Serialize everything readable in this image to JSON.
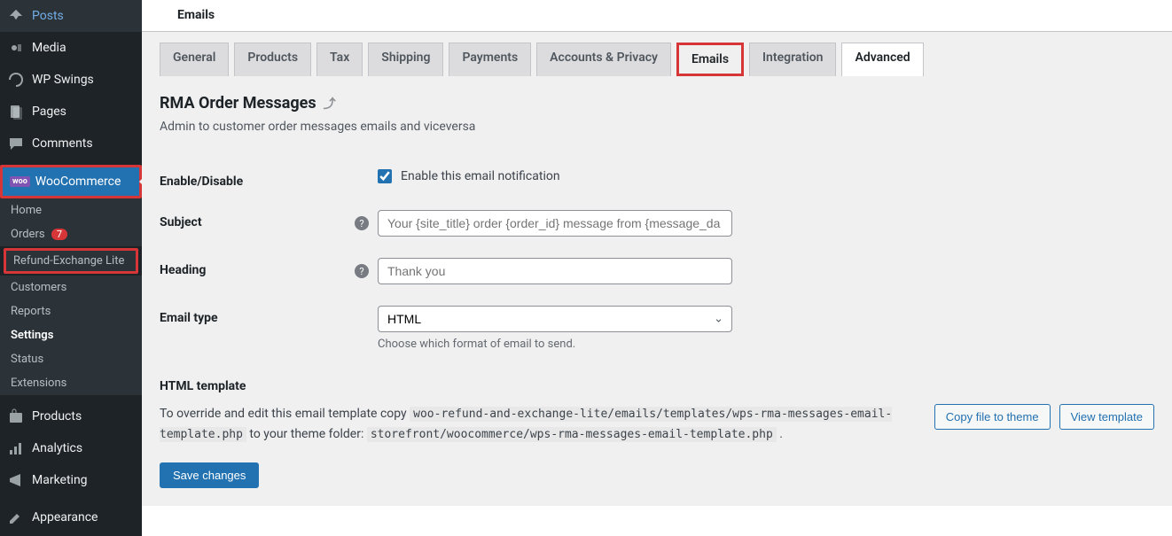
{
  "sidebar": {
    "items": [
      {
        "label": "Posts",
        "icon": "pin"
      },
      {
        "label": "Media",
        "icon": "media"
      },
      {
        "label": "WP Swings",
        "icon": "swings"
      },
      {
        "label": "Pages",
        "icon": "pages"
      },
      {
        "label": "Comments",
        "icon": "comment"
      }
    ],
    "woocommerce": {
      "label": "WooCommerce",
      "badge": "woo"
    },
    "wc_submenu": [
      {
        "label": "Home"
      },
      {
        "label": "Orders",
        "count": "7"
      },
      {
        "label": "Refund-Exchange Lite",
        "highlighted": true
      },
      {
        "label": "Customers"
      },
      {
        "label": "Reports"
      },
      {
        "label": "Settings",
        "current": true
      },
      {
        "label": "Status"
      },
      {
        "label": "Extensions"
      }
    ],
    "bottom": [
      {
        "label": "Products",
        "icon": "products"
      },
      {
        "label": "Analytics",
        "icon": "analytics"
      },
      {
        "label": "Marketing",
        "icon": "marketing"
      },
      {
        "label": "Appearance",
        "icon": "appearance"
      }
    ]
  },
  "page": {
    "header": "Emails",
    "tabs": [
      {
        "label": "General"
      },
      {
        "label": "Products"
      },
      {
        "label": "Tax"
      },
      {
        "label": "Shipping"
      },
      {
        "label": "Payments"
      },
      {
        "label": "Accounts & Privacy"
      },
      {
        "label": "Emails",
        "active": true,
        "highlighted": true
      },
      {
        "label": "Integration"
      },
      {
        "label": "Advanced",
        "white": true
      }
    ],
    "section_title": "RMA Order Messages",
    "section_desc": "Admin to customer order messages emails and viceversa",
    "form": {
      "enable_label": "Enable/Disable",
      "enable_checkbox_label": "Enable this email notification",
      "enable_checked": true,
      "subject_label": "Subject",
      "subject_placeholder": "Your {site_title} order {order_id} message from {message_da",
      "heading_label": "Heading",
      "heading_placeholder": "Thank you",
      "email_type_label": "Email type",
      "email_type_value": "HTML",
      "email_type_desc": "Choose which format of email to send."
    },
    "template": {
      "header": "HTML template",
      "text_prefix": "To override and edit this email template copy ",
      "code1": "woo-refund-and-exchange-lite/emails/templates/wps-rma-messages-email-template.php",
      "text_mid": " to your theme folder: ",
      "code2": "storefront/woocommerce/wps-rma-messages-email-template.php",
      "text_suffix": " .",
      "btn_copy": "Copy file to theme",
      "btn_view": "View template"
    },
    "save_btn": "Save changes"
  }
}
